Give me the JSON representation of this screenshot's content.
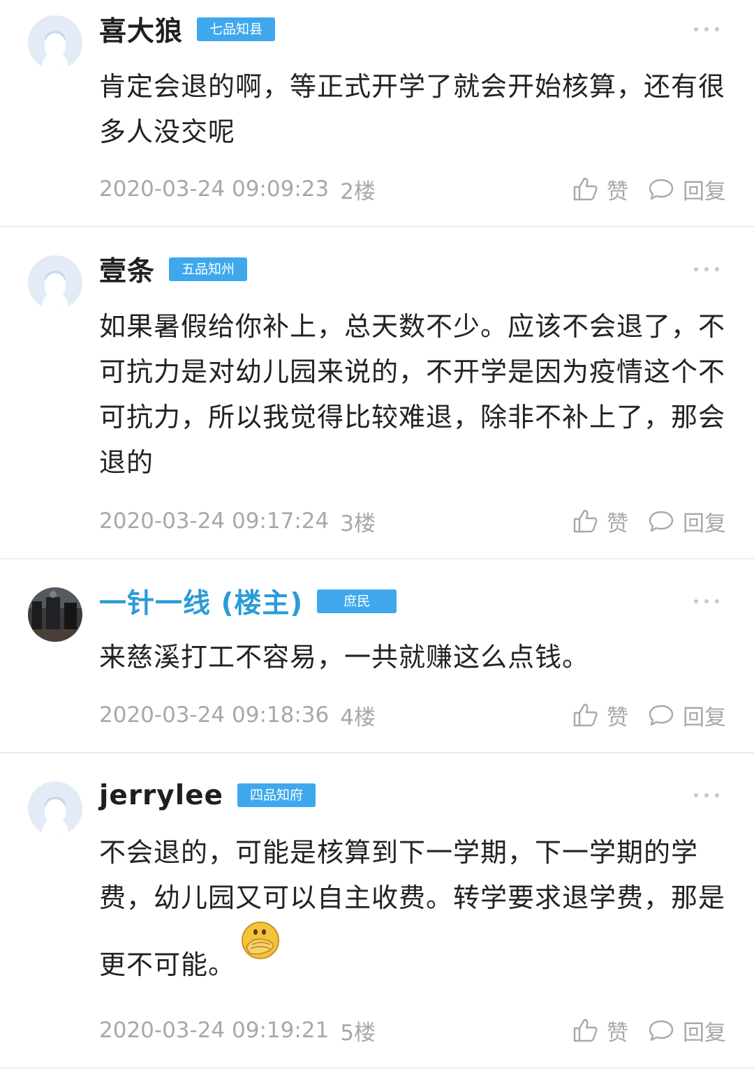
{
  "actions": {
    "like_label": "赞",
    "reply_label": "回复"
  },
  "comments": [
    {
      "username": "喜大狼",
      "badge": "七品知县",
      "text": "肯定会退的啊，等正式开学了就会开始核算，还有很多人没交呢",
      "time": "2020-03-24 09:09:23",
      "floor": "2楼"
    },
    {
      "username": "壹条",
      "badge": "五品知州",
      "text": "如果暑假给你补上，总天数不少。应该不会退了，不可抗力是对幼儿园来说的，不开学是因为疫情这个不可抗力，所以我觉得比较难退，除非不补上了，那会退的",
      "time": "2020-03-24 09:17:24",
      "floor": "3楼"
    },
    {
      "username": "一针一线 (楼主)",
      "badge": "庶民",
      "text": "来慈溪打工不容易，一共就赚这么点钱。",
      "time": "2020-03-24 09:18:36",
      "floor": "4楼"
    },
    {
      "username": "jerrylee",
      "badge": "四品知府",
      "text": "不会退的，可能是核算到下一学期，下一学期的学费，幼儿园又可以自主收费。转学要求退学费，那是更不可能。",
      "time": "2020-03-24 09:19:21",
      "floor": "5楼"
    }
  ],
  "colors": {
    "badge_bg": "#3fa8ec",
    "op_name": "#2b9bd8",
    "meta_text": "#a8a8a8",
    "divider": "#ececec"
  },
  "icons": {
    "like": "thumbs-up-icon",
    "reply": "speech-bubble-icon",
    "more": "more-dots-icon",
    "emoji": "covering-mouth-emoji-icon"
  }
}
